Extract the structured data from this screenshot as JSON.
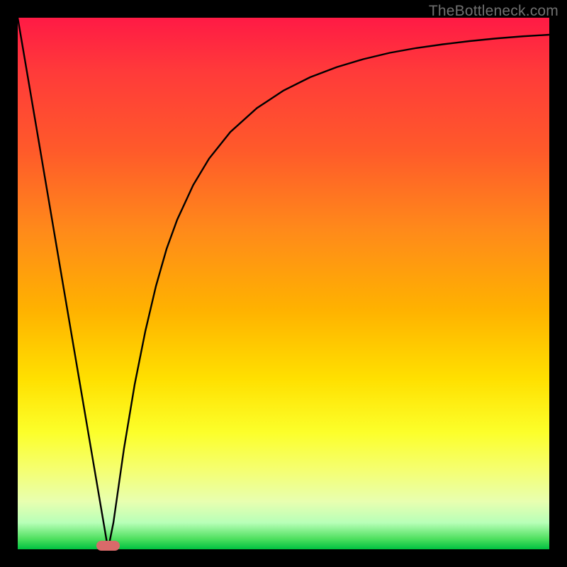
{
  "watermark": "TheBottleneck.com",
  "chart_data": {
    "type": "line",
    "title": "",
    "xlabel": "",
    "ylabel": "",
    "xlim": [
      0,
      100
    ],
    "ylim": [
      0,
      100
    ],
    "series": [
      {
        "name": "bottleneck-curve",
        "x": [
          0,
          4,
          8,
          12,
          16,
          17,
          18,
          19,
          20,
          22,
          24,
          26,
          28,
          30,
          33,
          36,
          40,
          45,
          50,
          55,
          60,
          65,
          70,
          75,
          80,
          85,
          90,
          95,
          100
        ],
        "y": [
          100,
          76.5,
          52.9,
          29.4,
          5.9,
          0,
          5,
          12,
          19,
          31,
          41,
          49.5,
          56.5,
          62,
          68.5,
          73.5,
          78.5,
          83,
          86.3,
          88.8,
          90.7,
          92.2,
          93.4,
          94.3,
          95.0,
          95.6,
          96.1,
          96.5,
          96.8
        ]
      }
    ],
    "marker": {
      "x_center": 17,
      "width_pct": 4.5,
      "y": 0
    },
    "background_gradient": {
      "stops": [
        {
          "pos": 0,
          "color": "#ff1a45"
        },
        {
          "pos": 25,
          "color": "#ff5a2a"
        },
        {
          "pos": 55,
          "color": "#ffb200"
        },
        {
          "pos": 78,
          "color": "#fcff2a"
        },
        {
          "pos": 95,
          "color": "#b8ffb8"
        },
        {
          "pos": 100,
          "color": "#00c040"
        }
      ]
    }
  }
}
